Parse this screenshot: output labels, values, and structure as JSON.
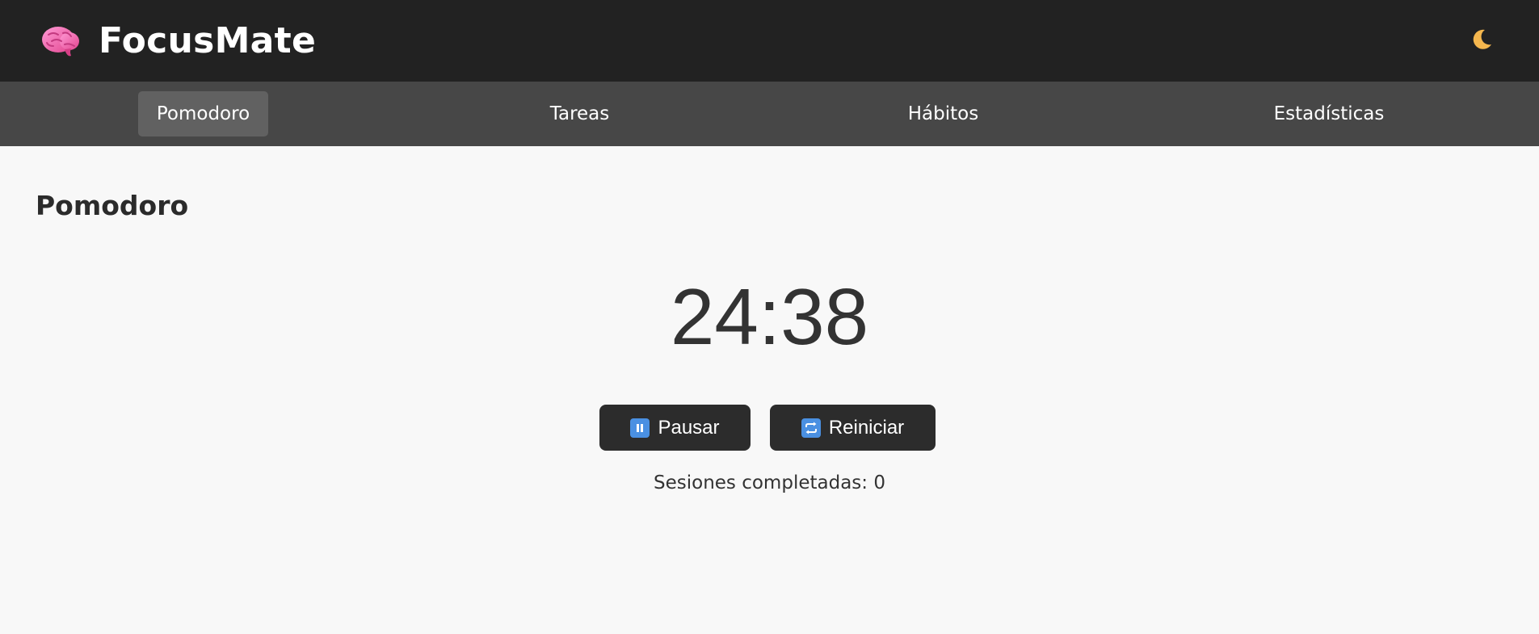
{
  "app": {
    "title": "FocusMate",
    "logo_icon": "brain-icon",
    "theme_toggle_icon": "crescent-moon-icon"
  },
  "nav": {
    "tabs": [
      {
        "label": "Pomodoro",
        "active": true
      },
      {
        "label": "Tareas",
        "active": false
      },
      {
        "label": "Hábitos",
        "active": false
      },
      {
        "label": "Estadísticas",
        "active": false
      }
    ]
  },
  "pomodoro": {
    "heading": "Pomodoro",
    "timer": "24:38",
    "pause_label": "Pausar",
    "pause_icon": "pause-icon",
    "reset_label": "Reiniciar",
    "reset_icon": "repeat-icon",
    "sessions_label": "Sesiones completadas:",
    "sessions_count": "0"
  },
  "colors": {
    "topbar_bg": "#222222",
    "navbar_bg": "#474747",
    "active_tab_bg": "#616161",
    "button_bg": "#2c2c2c",
    "icon_blue": "#4a90e2",
    "page_bg": "#f8f8f8"
  }
}
